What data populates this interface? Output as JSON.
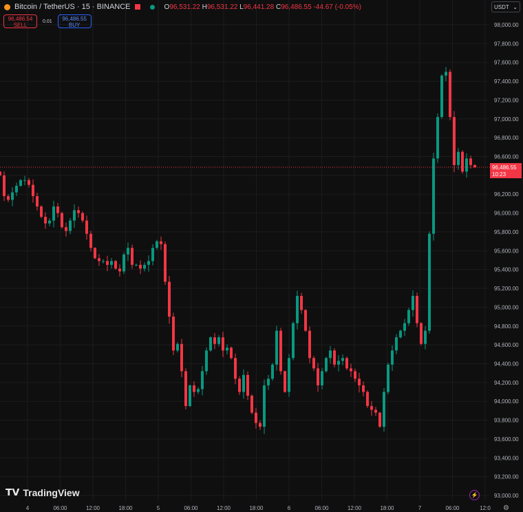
{
  "header": {
    "symbol": "Bitcoin / TetherUS · 15 · BINANCE",
    "open_label": "O",
    "open": "96,531.22",
    "high_label": "H",
    "high": "96,531.22",
    "low_label": "L",
    "low": "96,441.28",
    "close_label": "C",
    "close": "96,486.55",
    "change": "-44.67 (-0.05%)"
  },
  "trade": {
    "sell_price": "96,486.54",
    "sell_label": "SELL",
    "quantity": "0.01",
    "buy_price": "96,486.55",
    "buy_label": "BUY"
  },
  "currency_selector": {
    "value": "USDT",
    "icon": "chevron-down-icon"
  },
  "price_label": {
    "price": "96,486.55",
    "countdown": "10:23"
  },
  "brand": "TradingView",
  "colors": {
    "up": "#089981",
    "down": "#f23645",
    "background": "#0f0f0f",
    "grid": "#1c1c1c",
    "buy": "#2962ff"
  },
  "chart_data": {
    "type": "candlestick",
    "interval": "15",
    "ylim": [
      93000,
      98000
    ],
    "y_ticks": [
      "93,000.00",
      "93,200.00",
      "93,400.00",
      "93,600.00",
      "93,800.00",
      "94,000.00",
      "94,200.00",
      "94,400.00",
      "94,600.00",
      "94,800.00",
      "95,000.00",
      "95,200.00",
      "95,400.00",
      "95,600.00",
      "95,800.00",
      "96,000.00",
      "96,200.00",
      "96,400.00",
      "96,600.00",
      "96,800.00",
      "97,000.00",
      "97,200.00",
      "97,400.00",
      "97,600.00",
      "97,800.00",
      "98,000.00"
    ],
    "x_ticks": [
      "4",
      "06:00",
      "12:00",
      "18:00",
      "5",
      "06:00",
      "12:00",
      "18:00",
      "6",
      "06:00",
      "12:00",
      "18:00",
      "7",
      "06:00",
      "12:0"
    ],
    "grid": true,
    "last_price": 96486.55,
    "closes": [
      96400,
      96180,
      96140,
      96220,
      96290,
      96350,
      96350,
      96300,
      96180,
      96070,
      95960,
      95890,
      95920,
      96070,
      96000,
      95850,
      95810,
      95920,
      96030,
      96000,
      95920,
      95780,
      95630,
      95520,
      95490,
      95490,
      95450,
      95490,
      95410,
      95380,
      95560,
      95630,
      95450,
      95450,
      95410,
      95450,
      95490,
      95630,
      95700,
      95670,
      95270,
      94900,
      94540,
      94610,
      94320,
      93950,
      94170,
      94100,
      94130,
      94320,
      94540,
      94680,
      94610,
      94680,
      94540,
      94570,
      94460,
      94240,
      94100,
      94280,
      94060,
      93880,
      93770,
      93730,
      94170,
      94240,
      94390,
      94750,
      94320,
      94100,
      94460,
      94830,
      95120,
      94970,
      94750,
      94460,
      94350,
      94170,
      94320,
      94460,
      94540,
      94390,
      94430,
      94460,
      94350,
      94320,
      94240,
      94170,
      94100,
      93950,
      93910,
      93880,
      93730,
      94100,
      94390,
      94540,
      94680,
      94750,
      94830,
      94970,
      95120,
      94830,
      94610,
      94750,
      95780,
      96580,
      97020,
      97460,
      97500,
      97020,
      96510,
      96650,
      96440,
      96580,
      96510,
      96486.55
    ]
  }
}
